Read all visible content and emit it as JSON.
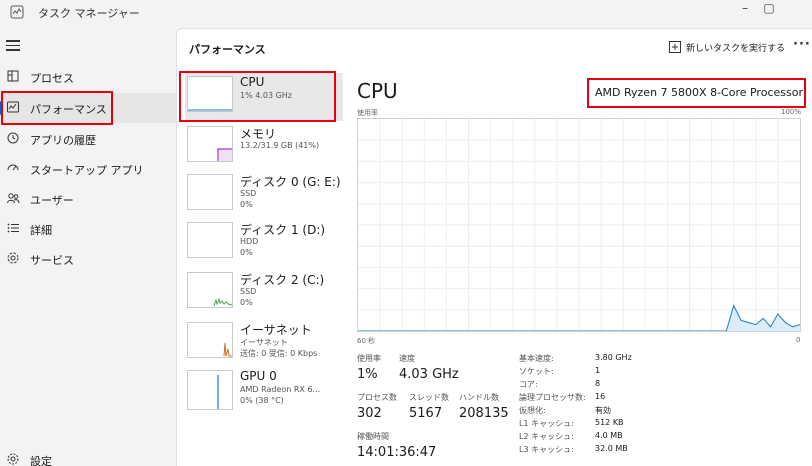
{
  "window": {
    "title": "タスク マネージャー"
  },
  "sidebar": {
    "items": [
      {
        "label": "プロセス",
        "icon": "processes-icon"
      },
      {
        "label": "パフォーマンス",
        "icon": "performance-icon",
        "active": true
      },
      {
        "label": "アプリの履歴",
        "icon": "history-icon"
      },
      {
        "label": "スタートアップ アプリ",
        "icon": "startup-icon"
      },
      {
        "label": "ユーザー",
        "icon": "users-icon"
      },
      {
        "label": "詳細",
        "icon": "details-icon"
      },
      {
        "label": "サービス",
        "icon": "services-icon"
      }
    ],
    "settings_label": "設定"
  },
  "header": {
    "title": "パフォーマンス",
    "run_task_label": "新しいタスクを実行する",
    "more_label": "···"
  },
  "devices": [
    {
      "name": "CPU",
      "sub1": "1% 4.03 GHz",
      "sub2": ""
    },
    {
      "name": "メモリ",
      "sub1": "13.2/31.9 GB (41%)",
      "sub2": ""
    },
    {
      "name": "ディスク 0 (G: E:)",
      "sub1": "SSD",
      "sub2": "0%"
    },
    {
      "name": "ディスク 1 (D:)",
      "sub1": "HDD",
      "sub2": "0%"
    },
    {
      "name": "ディスク 2 (C:)",
      "sub1": "SSD",
      "sub2": "0%"
    },
    {
      "name": "イーサネット",
      "sub1": "イーサネット",
      "sub2": "送信: 0 受信: 0 Kbps"
    },
    {
      "name": "GPU 0",
      "sub1": "AMD Radeon RX 6...",
      "sub2": "0% (38 °C)"
    }
  ],
  "detail": {
    "title": "CPU",
    "model": "AMD Ryzen 7 5800X 8-Core Processor",
    "usage_label": "使用率",
    "max_label": "100%",
    "time_label": "60 秒",
    "min_label": "0",
    "stats": {
      "usage_label": "使用率",
      "usage_value": "1%",
      "speed_label": "速度",
      "speed_value": "4.03 GHz",
      "processes_label": "プロセス数",
      "processes_value": "302",
      "threads_label": "スレッド数",
      "threads_value": "5167",
      "handles_label": "ハンドル数",
      "handles_value": "208135",
      "uptime_label": "稼働時間",
      "uptime_value": "14:01:36:47"
    },
    "specs": [
      {
        "key": "基本速度:",
        "value": "3.80 GHz"
      },
      {
        "key": "ソケット:",
        "value": "1"
      },
      {
        "key": "コア:",
        "value": "8"
      },
      {
        "key": "論理プロセッサ数:",
        "value": "16"
      },
      {
        "key": "仮想化:",
        "value": "有効"
      },
      {
        "key": "L1 キャッシュ:",
        "value": "512 KB"
      },
      {
        "key": "L2 キャッシュ:",
        "value": "4.0 MB"
      },
      {
        "key": "L3 キャッシュ:",
        "value": "32.0 MB"
      }
    ]
  },
  "colors": {
    "cpu_graph": "#1a7fc1",
    "memory_graph": "#a23cc6",
    "disk_graph": "#4ca64c",
    "ethernet_graph": "#c87020",
    "gpu_graph": "#1a7fc1",
    "highlight": "#e60012",
    "accent": "#0067c0"
  },
  "chart_data": {
    "type": "area",
    "x": [
      0,
      1,
      2,
      3,
      4,
      5,
      6,
      7,
      8,
      9,
      10,
      11,
      12,
      13,
      14,
      15,
      16,
      17,
      18,
      19,
      20,
      21,
      22,
      23,
      24,
      25,
      26,
      27,
      28,
      29,
      30,
      31,
      32,
      33,
      34,
      35,
      36,
      37,
      38,
      39,
      40,
      41,
      42,
      43,
      44,
      45,
      46,
      47,
      48,
      49,
      50,
      51,
      52,
      53,
      54,
      55,
      56,
      57,
      58,
      59,
      60
    ],
    "values": [
      0,
      0,
      0,
      0,
      0,
      0,
      0,
      0,
      0,
      0,
      0,
      0,
      0,
      0,
      0,
      0,
      0,
      0,
      0,
      0,
      0,
      0,
      0,
      0,
      0,
      0,
      0,
      0,
      0,
      0,
      0,
      0,
      0,
      0,
      0,
      0,
      0,
      0,
      0,
      0,
      0,
      0,
      0,
      0,
      0,
      0,
      0,
      0,
      0,
      0,
      0,
      12,
      5,
      4,
      3,
      6,
      2,
      8,
      4,
      2,
      3
    ],
    "xlim": [
      60,
      0
    ],
    "ylim": [
      0,
      100
    ],
    "ylabel": "使用率",
    "grid": true
  }
}
